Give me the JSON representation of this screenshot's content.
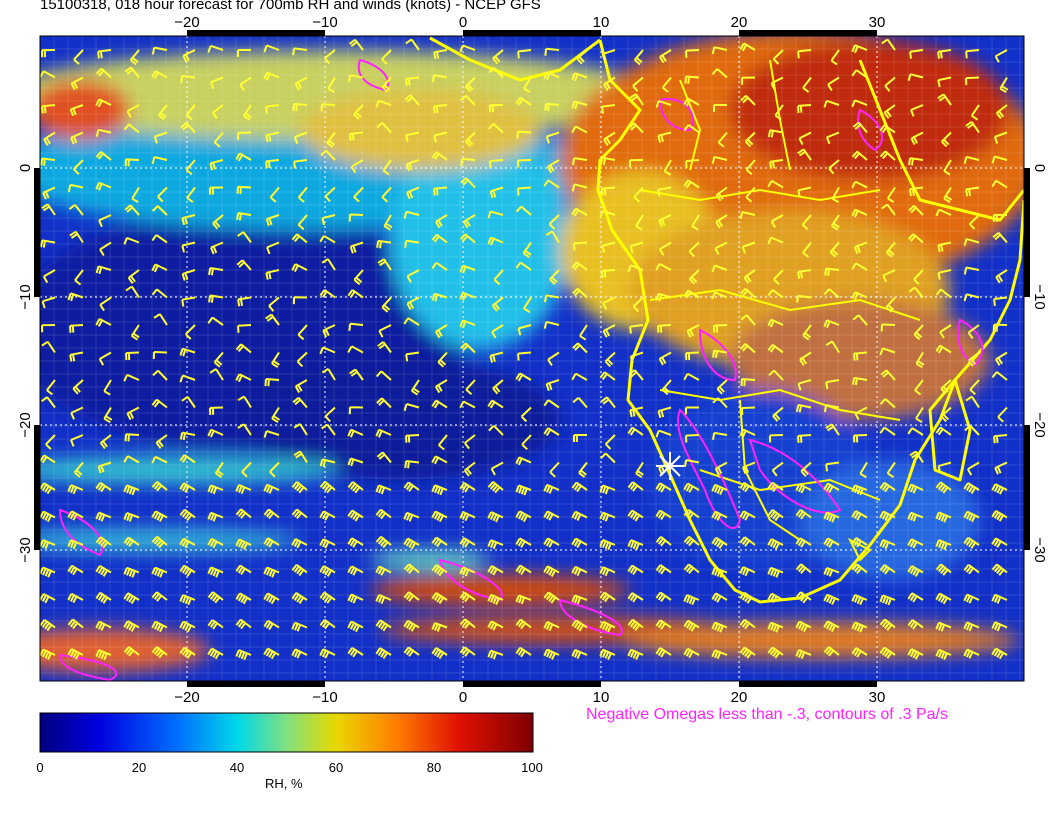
{
  "title": "15100318, 018 hour forecast for 700mb RH and winds (knots) - NCEP GFS",
  "lon_ticks": [
    "−20",
    "−10",
    "0",
    "10",
    "20",
    "30"
  ],
  "lat_ticks": [
    "0",
    "−10",
    "−20",
    "−30"
  ],
  "omega_note": "Negative Omegas less than -.3, contours of .3 Pa/s",
  "colorbar": {
    "label": "RH, %",
    "ticks": [
      "0",
      "20",
      "40",
      "60",
      "80",
      "100"
    ],
    "range": [
      0,
      100
    ]
  },
  "colors": {
    "barbs": "#ffff33",
    "coast": "#ffff00",
    "omega": "#ff22ff",
    "grid": "#ffffff"
  }
}
